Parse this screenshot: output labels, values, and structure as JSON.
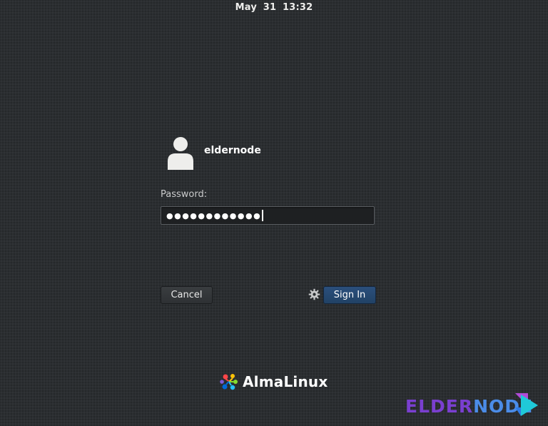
{
  "topbar": {
    "date": "May 31",
    "time": "13:32"
  },
  "login": {
    "username": "eldernode",
    "password_label": "Password:",
    "password_value": "●●●●●●●●●●●●",
    "cancel_label": "Cancel",
    "signin_label": "Sign In"
  },
  "branding": {
    "os_name": "AlmaLinux",
    "watermark_part1": "ELDER",
    "watermark_part2": "NODE"
  },
  "icons": {
    "avatar": "user-avatar-icon",
    "settings": "gear-icon",
    "os_logo": "almalinux-logo-icon"
  },
  "colors": {
    "background": "#2b2e31",
    "signin_button": "#264a74",
    "text": "#eeeeec"
  }
}
